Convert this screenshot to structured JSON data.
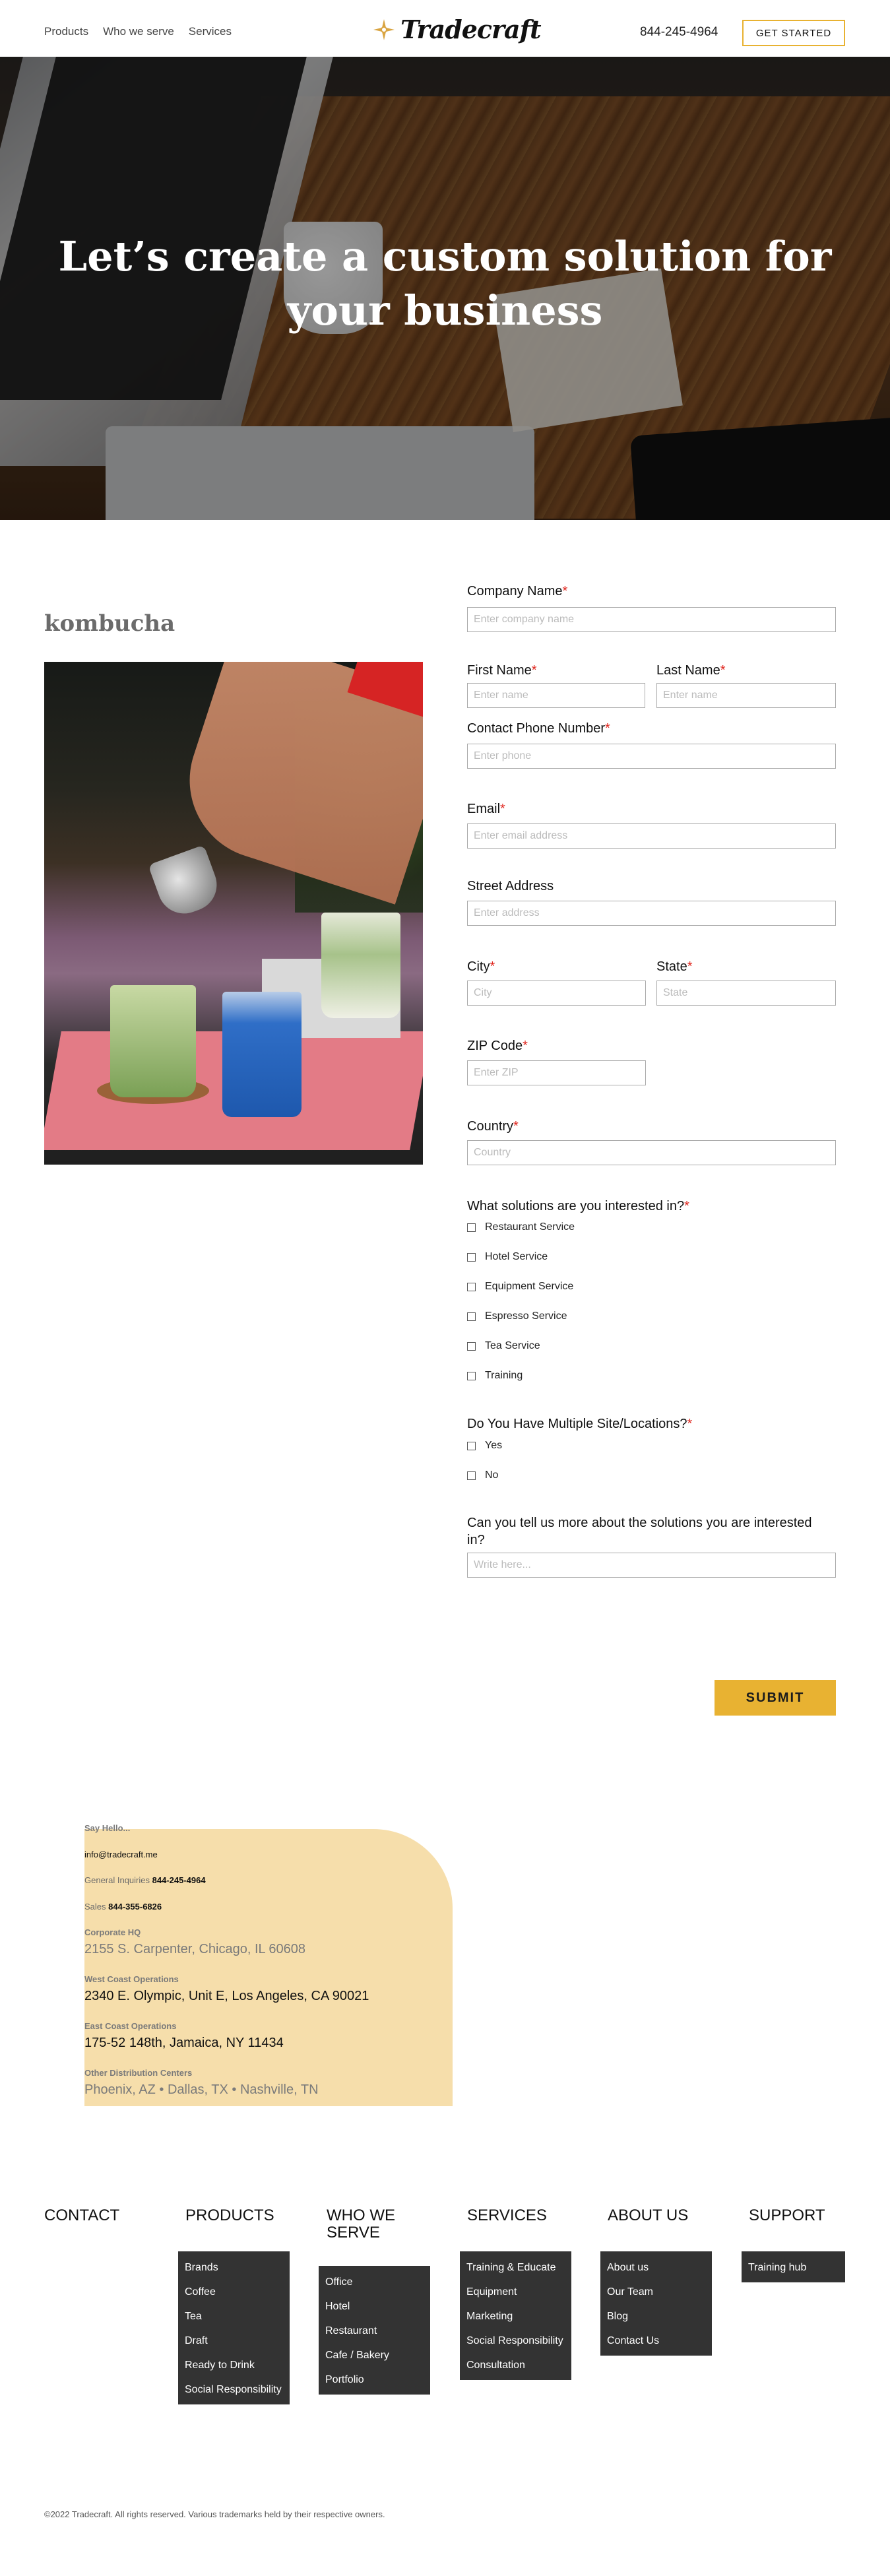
{
  "header": {
    "nav": [
      "Products",
      "Who we serve",
      "Services"
    ],
    "logo_text": "Tradecraft",
    "phone": "844-245-4964",
    "cta": "GET STARTED"
  },
  "hero": {
    "title_line1": "Let’s create a custom solution for",
    "title_line2": "your business"
  },
  "product": {
    "name": "kombucha"
  },
  "form": {
    "company_label": "Company Name",
    "company_placeholder": "Enter company name",
    "first_label": "First Name",
    "first_placeholder": "Enter name",
    "last_label": "Last Name",
    "last_placeholder": "Enter name",
    "phone_label": "Contact Phone Number",
    "phone_placeholder": "Enter phone",
    "email_label": "Email",
    "email_placeholder": "Enter email address",
    "street_label": "Street Address",
    "street_placeholder": "Enter address",
    "city_label": "City",
    "city_placeholder": "City",
    "state_label": "State",
    "state_placeholder": "State",
    "zip_label": "ZIP Code",
    "zip_placeholder": "Enter ZIP",
    "country_label": "Country",
    "country_placeholder": "Country",
    "solutions_label": "What solutions are you interested in?",
    "solutions": [
      "Restaurant Service",
      "Hotel Service",
      "Equipment Service",
      "Espresso Service",
      "Tea Service",
      "Training"
    ],
    "multi_label": "Do You Have Multiple Site/Locations?",
    "multi_options": [
      "Yes",
      "No"
    ],
    "more_label_line1": "Can you tell us more about the solutions you are interested",
    "more_label_line2": "in?",
    "more_placeholder": "Write here...",
    "required_mark": "*",
    "submit": "SUBMIT"
  },
  "contact": {
    "say_hello": "Say Hello...",
    "email": "info@tradecraft.me",
    "general_label": "General Inquiries",
    "general_phone": "844-245-4964",
    "sales_label": "Sales",
    "sales_phone": "844-355-6826",
    "hq_label": "Corporate HQ",
    "hq_address": "2155 S. Carpenter, Chicago, IL 60608",
    "west_label": "West Coast Operations",
    "west_address": "2340 E. Olympic, Unit E, Los Angeles, CA 90021",
    "east_label": "East Coast Operations",
    "east_address": "175-52 148th, Jamaica, NY 11434",
    "other_label": "Other Distribution Centers",
    "other_address": "Phoenix, AZ • Dallas, TX • Nashville, TN"
  },
  "footer": {
    "contact": {
      "title": "CONTACT"
    },
    "products": {
      "title": "PRODUCTS",
      "items": [
        "Brands",
        "Coffee",
        "Tea",
        "Draft",
        "Ready to Drink",
        "Social Responsibility"
      ]
    },
    "who": {
      "title_line1": "WHO WE",
      "title_line2": "SERVE",
      "items": [
        "Office",
        "Hotel",
        "Restaurant",
        "Cafe / Bakery",
        "Portfolio"
      ]
    },
    "services": {
      "title": "SERVICES",
      "items": [
        "Training & Educate",
        "Equipment",
        "Marketing",
        "Social Responsibility",
        "Consultation"
      ]
    },
    "about": {
      "title": "ABOUT US",
      "items": [
        "About us",
        "Our Team",
        "Blog",
        "Contact Us"
      ]
    },
    "support": {
      "title": "SUPPORT",
      "items": [
        "Training hub"
      ]
    },
    "copyright": "©2022 Tradecraft. All rights reserved. Various trademarks held by their respective owners."
  },
  "colors": {
    "accent": "#e8b232",
    "card": "#f6deab",
    "menu": "#333333",
    "required": "#e0271f"
  }
}
